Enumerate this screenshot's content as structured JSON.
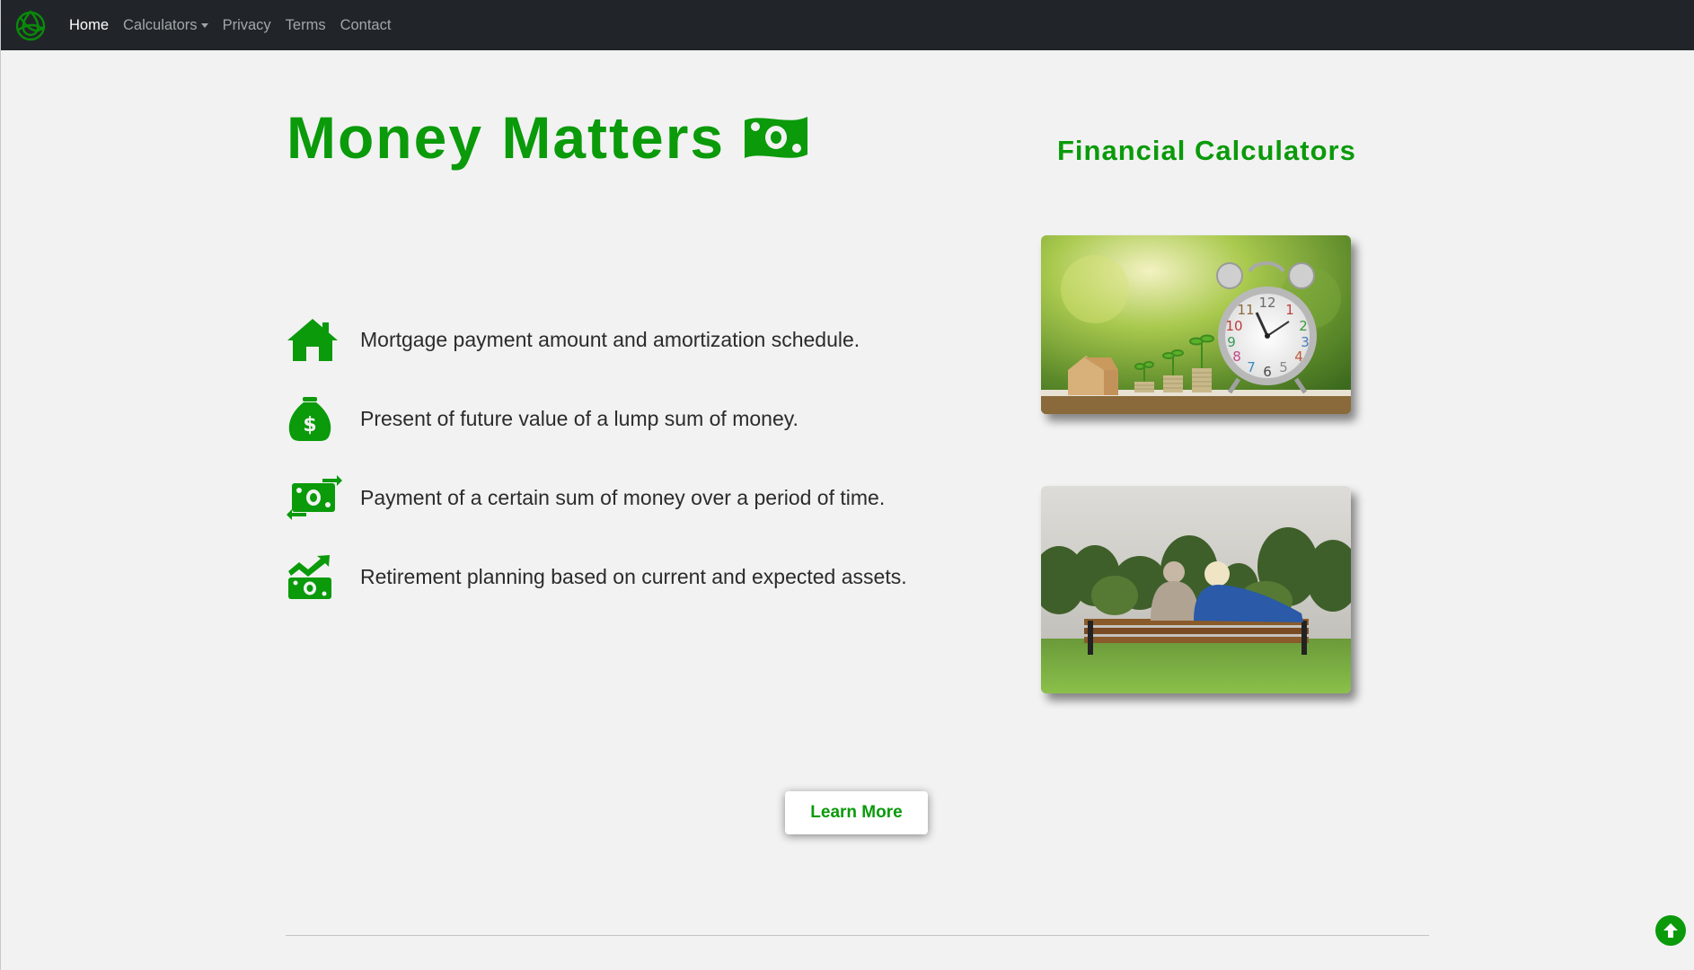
{
  "nav": {
    "items": [
      {
        "label": "Home",
        "active": true
      },
      {
        "label": "Calculators",
        "dropdown": true
      },
      {
        "label": "Privacy"
      },
      {
        "label": "Terms"
      },
      {
        "label": "Contact"
      }
    ]
  },
  "hero": {
    "title": "Money Matters",
    "title_icon": "money-bill-icon"
  },
  "sidebar": {
    "title": "Financial Calculators",
    "images": [
      {
        "name": "alarm-clock-coins-photo"
      },
      {
        "name": "couple-on-bench-photo"
      }
    ]
  },
  "features": [
    {
      "icon": "house-icon",
      "text": "Mortgage payment amount and amortization schedule."
    },
    {
      "icon": "money-bag-icon",
      "text": "Present of future value of a lump sum of money."
    },
    {
      "icon": "money-exchange-icon",
      "text": "Payment of a certain sum of money over a period of time."
    },
    {
      "icon": "money-growth-icon",
      "text": "Retirement planning based on current and expected assets."
    }
  ],
  "cta": {
    "label": "Learn More"
  },
  "colors": {
    "accent": "#0a9a0a",
    "navbar": "#212529",
    "background": "#f2f2f2"
  }
}
